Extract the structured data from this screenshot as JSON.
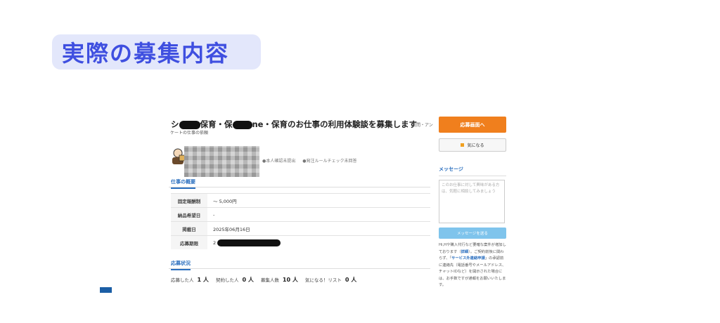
{
  "header": {
    "title": "実際の募集内容"
  },
  "job": {
    "title_prefix": "シ",
    "title_part1": "保育・保",
    "title_part2": "ne・保育のお仕事の利用体験談を募集します",
    "category": "質問・アン",
    "subline": "ケートの仕事の依頼",
    "tags": [
      "本人確認未提出",
      "発注ルールチェック未回答"
    ]
  },
  "overview": {
    "section_label": "仕事の概要",
    "rows": [
      {
        "key": "固定報酬制",
        "value": "〜 5,000円"
      },
      {
        "key": "納品希望日",
        "value": "-"
      },
      {
        "key": "掲載日",
        "value": "2025年06月16日"
      },
      {
        "key": "応募期限",
        "value": "2"
      }
    ]
  },
  "applications": {
    "section_label": "応募状況",
    "stats": [
      {
        "label": "応募した人",
        "value": "1",
        "unit": "人"
      },
      {
        "label": "契約した人",
        "value": "0",
        "unit": "人"
      },
      {
        "label": "募集人数",
        "value": "10",
        "unit": "人"
      },
      {
        "label": "気になる！リスト",
        "value": "0",
        "unit": "人"
      }
    ]
  },
  "sidebar": {
    "apply_label": "応募画面へ",
    "favorite_label": "気になる",
    "message_heading": "メッセージ",
    "message_placeholder": "このお仕事に対して興味がある方は、気軽に相談してみましょう",
    "send_label": "メッセージを送る",
    "notice": {
      "p1": "Hi,Hや購入代行など要確な案件が増加しております（",
      "detail_link": "詳細",
      "p2": "）。ご契約前後に関わらず、「",
      "service_link": "サービス外連絡申請",
      "p3": "」の承認前に連絡先（電話番号やメールアドレス、チャットIDなど）を開示された場合には、お手数ですが",
      "p4": "通報をお願いいたします。"
    }
  },
  "colors": {
    "accent": "#3f4fe0",
    "apply": "#f07f1d",
    "link": "#2b6fbf"
  }
}
